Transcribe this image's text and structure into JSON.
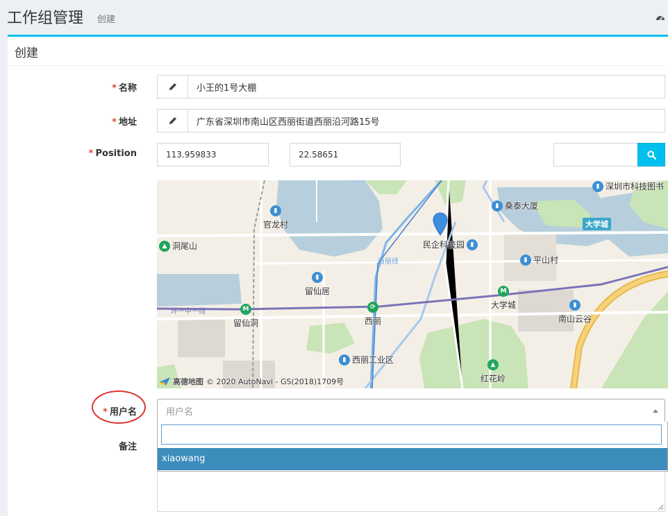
{
  "header": {
    "title": "工作组管理",
    "subtitle": "创建",
    "dashboard_icon": "tachometer-icon"
  },
  "box": {
    "title": "创建"
  },
  "form": {
    "name": {
      "label": "名称",
      "required": "*",
      "value": "小王的1号大棚",
      "icon": "pencil-icon"
    },
    "address": {
      "label": "地址",
      "required": "*",
      "value": "广东省深圳市南山区西丽街道西丽沿河路15号",
      "icon": "pencil-icon"
    },
    "position": {
      "label": "Position",
      "required": "*",
      "longitude": "113.959833",
      "latitude": "22.58651",
      "search_value": "",
      "search_icon": "search-icon"
    },
    "username": {
      "label": "用户名",
      "required": "*",
      "placeholder": "用户名",
      "search_value": "",
      "options": [
        "xiaowang"
      ],
      "highlighted_option": "xiaowang"
    },
    "remark": {
      "label": "备注",
      "value": ""
    }
  },
  "map": {
    "pois": {
      "shenzhen_library": "深圳市科技图书",
      "sangtai": "桑泰大厦",
      "guanlong": "官龙村",
      "minqi": "民企科技园",
      "dongwei": "洞尾山",
      "pingshan": "平山村",
      "liuxianju": "留仙居",
      "daxuecheng": "大学城",
      "liuxiandong": "留仙洞",
      "xili": "西丽",
      "nanshan_yungu": "南山云谷",
      "xili_industrial": "西丽工业区",
      "honghualing": "红花岭"
    },
    "campus_badge": "大学城",
    "road_labels": {
      "xili_line": "西丽线",
      "huanzhong": "环一中一线"
    },
    "logo": "高德地图",
    "attribution": "© 2020 AutoNavi - GS(2018)1709号",
    "marker_icon": "map-marker-icon"
  },
  "colors": {
    "accent": "#00c0ef",
    "required": "#dd4b39",
    "selected_option": "#3c8dbc",
    "highlight_ellipse": "#d9322e"
  }
}
